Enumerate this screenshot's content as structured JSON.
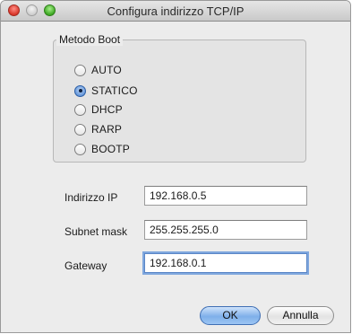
{
  "window": {
    "title": "Configura indirizzo TCP/IP"
  },
  "boot_method": {
    "label": "Metodo Boot",
    "options": [
      "AUTO",
      "STATICO",
      "DHCP",
      "RARP",
      "BOOTP"
    ],
    "selected": "STATICO"
  },
  "fields": {
    "ip": {
      "label": "Indirizzo IP",
      "value": "192.168.0.5"
    },
    "subnet": {
      "label": "Subnet mask",
      "value": "255.255.255.0"
    },
    "gateway": {
      "label": "Gateway",
      "value": "192.168.0.1"
    }
  },
  "buttons": {
    "ok": "OK",
    "cancel": "Annulla"
  },
  "colors": {
    "accent": "#5b8fd6"
  }
}
